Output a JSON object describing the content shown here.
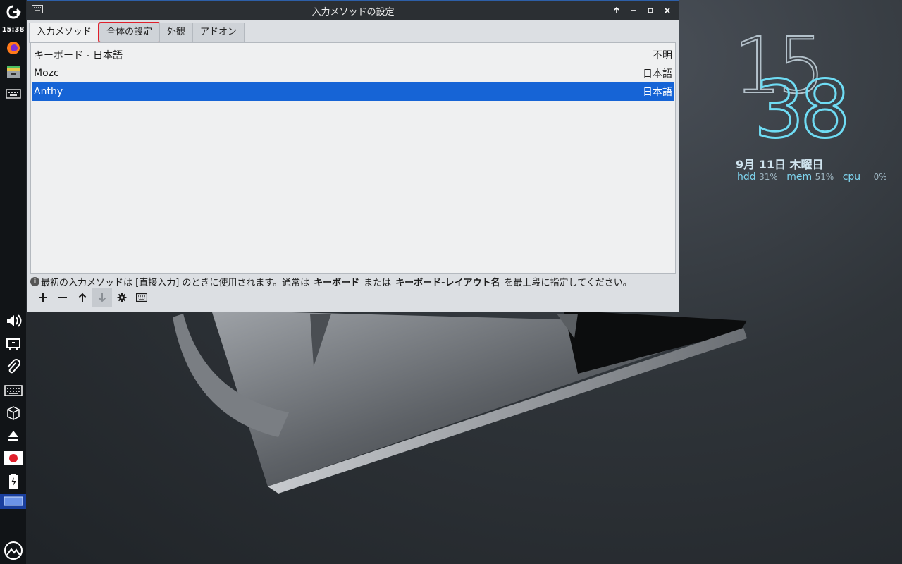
{
  "panel": {
    "time": "15:38"
  },
  "window": {
    "title": "入力メソッドの設定",
    "tabs": [
      {
        "label": "入力メソッド"
      },
      {
        "label": "全体の設定"
      },
      {
        "label": "外観"
      },
      {
        "label": "アドオン"
      }
    ],
    "methods": [
      {
        "name": "キーボード - 日本語",
        "lang": "不明"
      },
      {
        "name": "Mozc",
        "lang": "日本語"
      },
      {
        "name": "Anthy",
        "lang": "日本語"
      }
    ],
    "hint": {
      "part1": "最初の入力メソッドは [直接入力] のときに使用されます。通常は",
      "bold1": "キーボード",
      "part2": "または",
      "bold2": "キーボード-レイアウト名",
      "part3": "を最上段に指定してください。"
    }
  },
  "desktop_clock": {
    "hour": "15",
    "minute": "38",
    "date": "9月  11日  木曜日",
    "hdd_label": "hdd",
    "hdd_val": "31%",
    "mem_label": "mem",
    "mem_val": "51%",
    "cpu_label": "cpu",
    "cpu_val": "0%"
  },
  "colors": {
    "selection": "#1664d6",
    "highlight": "#e0202c",
    "clock_accent": "#6fdcf4"
  }
}
